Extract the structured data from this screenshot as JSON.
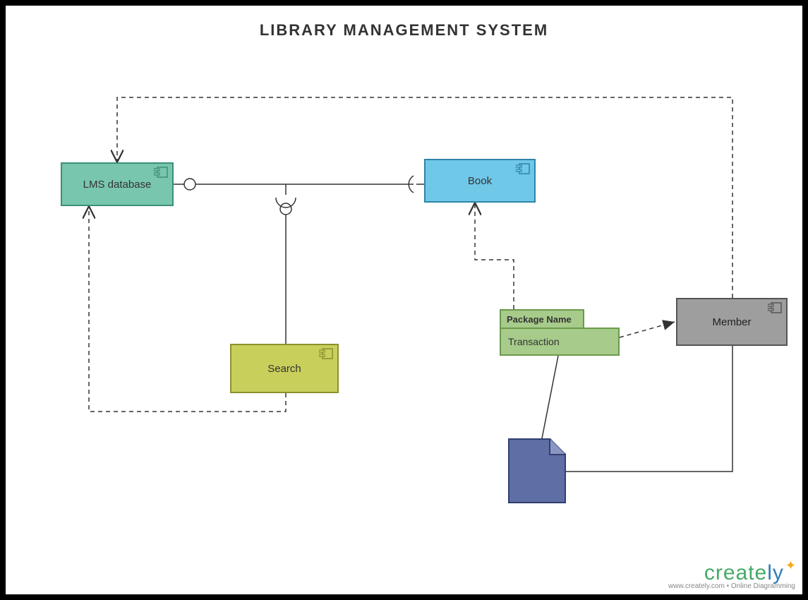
{
  "title": "LIBRARY MANAGEMENT SYSTEM",
  "components": {
    "lms": {
      "label": "LMS database"
    },
    "book": {
      "label": "Book"
    },
    "search": {
      "label": "Search"
    },
    "member": {
      "label": "Member"
    }
  },
  "package": {
    "name": "Package Name",
    "inner": "Transaction"
  },
  "artifact": {
    "kind": "document"
  },
  "connectors": [
    {
      "from": "lms",
      "to": "book",
      "style": "solid",
      "interface": "provided-required",
      "arrow": "none"
    },
    {
      "from": "search",
      "to": "lms-book-link",
      "style": "solid",
      "interface": "required-socket",
      "arrow": "none"
    },
    {
      "from": "member",
      "to": "lms",
      "style": "dashed",
      "arrow": "open",
      "path": "top-over"
    },
    {
      "from": "search",
      "to": "lms",
      "style": "dashed",
      "arrow": "open",
      "path": "bottom-left"
    },
    {
      "from": "package",
      "to": "book",
      "style": "dashed",
      "arrow": "open"
    },
    {
      "from": "package",
      "to": "member",
      "style": "dashed",
      "arrow": "filled"
    },
    {
      "from": "package",
      "to": "document",
      "style": "solid",
      "arrow": "none"
    },
    {
      "from": "document",
      "to": "member",
      "style": "solid",
      "arrow": "none"
    }
  ],
  "footer": {
    "brand_left": "create",
    "brand_right": "ly",
    "tagline": "www.creately.com • Online Diagramming"
  }
}
